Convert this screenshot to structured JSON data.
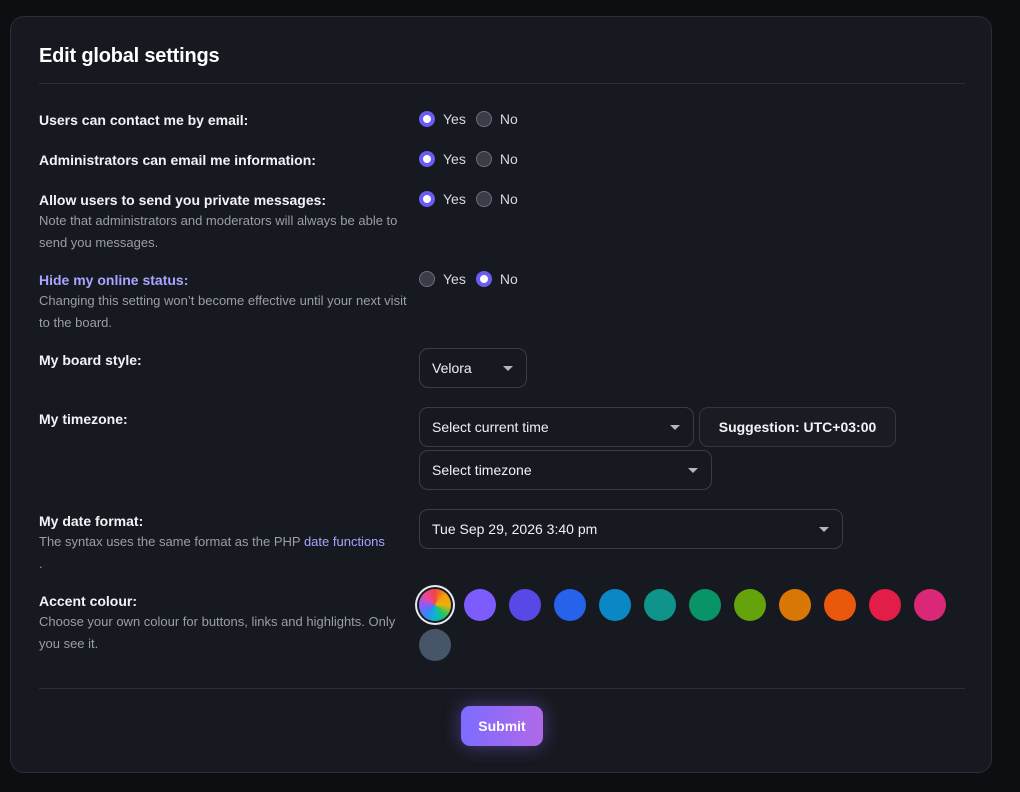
{
  "page": {
    "title": "Edit global settings",
    "accent_color": "#6a5cf5",
    "link_color": "#a9a4ff"
  },
  "settings": {
    "contact_email": {
      "label": "Users can contact me by email:",
      "yes_label": "Yes",
      "no_label": "No",
      "selected": "Yes"
    },
    "admin_email": {
      "label": "Administrators can email me information:",
      "yes_label": "Yes",
      "no_label": "No",
      "selected": "Yes"
    },
    "private_messages": {
      "label": "Allow users to send you private messages:",
      "description": "Note that administrators and moderators will always be able to send you messages.",
      "yes_label": "Yes",
      "no_label": "No",
      "selected": "Yes"
    },
    "hide_online": {
      "label": "Hide my online status:",
      "description": "Changing this setting won’t become effective until your next visit to the board.",
      "yes_label": "Yes",
      "no_label": "No",
      "selected": "No"
    },
    "board_style": {
      "label": "My board style:",
      "value": "Velora"
    },
    "timezone": {
      "label": "My timezone:",
      "time_select": "Select current time",
      "suggestion": "Suggestion: UTC+03:00",
      "zone_select": "Select timezone"
    },
    "date_format": {
      "label": "My date format:",
      "description_prefix": "The syntax uses the same format as the PHP",
      "description_link": "date functions",
      "description_suffix": ".",
      "value": "Tue Sep 29, 2026 3:40 pm"
    },
    "accent_colour": {
      "label": "Accent colour:",
      "description": "Choose your own colour for buttons, links and highlights. Only you see it.",
      "selected": "rainbow",
      "swatches": [
        "rainbow",
        "#7c5cfc",
        "#5848e5",
        "#2563eb",
        "#0a88c6",
        "#0e948a",
        "#089467",
        "#65a30d",
        "#d97706",
        "#ea580c",
        "#e11d48",
        "#db2777",
        "#475569"
      ]
    }
  },
  "submit_label": "Submit"
}
